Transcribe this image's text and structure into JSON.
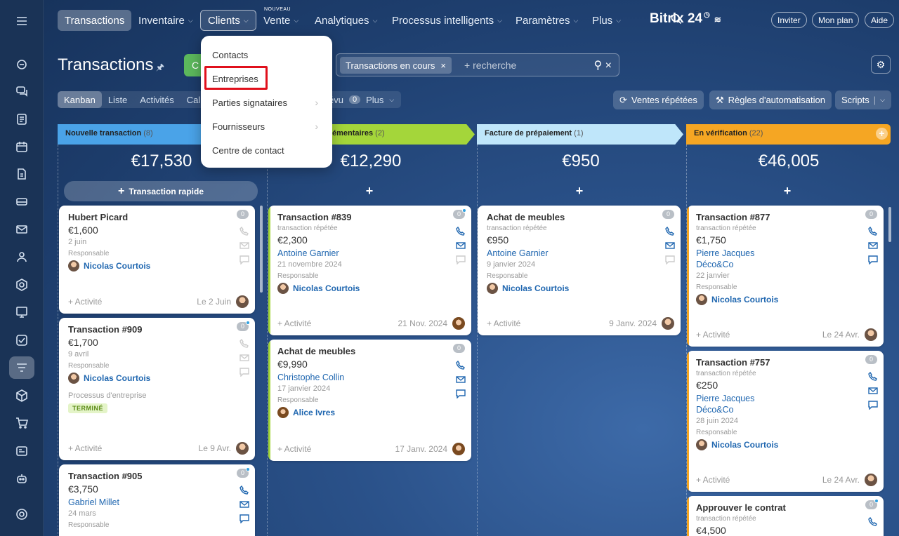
{
  "nav": {
    "items": [
      "Transactions",
      "Inventaire",
      "Clients",
      "Vente",
      "Analytiques",
      "Processus intelligents",
      "Paramètres",
      "Plus"
    ],
    "new_tag": "NOUVEAU",
    "logo": "Bitrix 24",
    "invite": "Inviter",
    "plan": "Mon plan",
    "help": "Aide"
  },
  "dropdown": {
    "items": [
      "Contacts",
      "Entreprises",
      "Parties signataires",
      "Fournisseurs",
      "Centre de contact"
    ]
  },
  "page": {
    "title": "Transactions",
    "create_label": "C",
    "filter_tag": "Transactions en cours",
    "filter_placeholder": "+ recherche"
  },
  "views": {
    "items": [
      "Kanban",
      "Liste",
      "Activités",
      "Cal"
    ],
    "extra_label": "évu",
    "extra_count": "0",
    "more": "Plus"
  },
  "toolbar": {
    "repeat_sales": "Ventes répétées",
    "automation": "Règles d'automatisation",
    "scripts": "Scripts"
  },
  "columns": [
    {
      "name": "Nouvelle transaction",
      "count": "(8)",
      "sum": "€17,530",
      "color": "#4aa3e8"
    },
    {
      "name": "émentaires",
      "count": "(2)",
      "sum": "€12,290",
      "color": "#a4d63a"
    },
    {
      "name": "Facture de prépaiement",
      "count": "(1)",
      "sum": "€950",
      "color": "#bfe6fa"
    },
    {
      "name": "En vérification",
      "count": "(22)",
      "sum": "€46,005",
      "color": "#f5a623"
    }
  ],
  "quick_add": "Transaction rapide",
  "labels": {
    "responsible": "Responsable",
    "activity": "+ Activité"
  },
  "cards": {
    "c1": {
      "title": "Hubert Picard",
      "amount": "€1,600",
      "date": "2 juin",
      "resp": "Nicolas Courtois",
      "footer_date": "Le 2 Juin",
      "badge": "0"
    },
    "c2": {
      "title": "Transaction #909",
      "amount": "€1,700",
      "date": "9 avril",
      "resp": "Nicolas Courtois",
      "process": "Processus d'entreprise",
      "status": "TERMINÉ",
      "footer_date": "Le 9 Avr.",
      "badge": "0"
    },
    "c3": {
      "title": "Transaction #905",
      "amount": "€3,750",
      "contact": "Gabriel Millet",
      "date": "24 mars",
      "badge": "0"
    },
    "c4": {
      "title": "Transaction #839",
      "sub": "transaction répétée",
      "amount": "€2,300",
      "contact": "Antoine Garnier",
      "date": "21 novembre 2024",
      "resp": "Nicolas Courtois",
      "footer_date": "21 Nov. 2024",
      "badge": "0"
    },
    "c5": {
      "title": "Achat de meubles",
      "amount": "€9,990",
      "contact": "Christophe Collin",
      "date": "17 janvier 2024",
      "resp": "Alice Ivres",
      "footer_date": "17 Janv. 2024",
      "badge": "0"
    },
    "c6": {
      "title": "Achat de meubles",
      "sub": "transaction répétée",
      "amount": "€950",
      "contact": "Antoine Garnier",
      "date": "9 janvier 2024",
      "resp": "Nicolas Courtois",
      "footer_date": "9 Janv. 2024",
      "badge": "0"
    },
    "c7": {
      "title": "Transaction #877",
      "sub": "transaction répétée",
      "amount": "€1,750",
      "contact": "Pierre Jacques",
      "company": "Déco&Co",
      "date": "22 janvier",
      "resp": "Nicolas Courtois",
      "footer_date": "Le 24 Avr.",
      "badge": "0"
    },
    "c8": {
      "title": "Transaction #757",
      "sub": "transaction répétée",
      "amount": "€250",
      "contact": "Pierre Jacques",
      "company": "Déco&Co",
      "date": "28 juin 2024",
      "resp": "Nicolas Courtois",
      "footer_date": "Le 24 Avr.",
      "badge": "0"
    },
    "c9": {
      "title": "Approuver le contrat",
      "sub": "transaction répétée",
      "amount": "€4,500",
      "badge": "0"
    }
  }
}
